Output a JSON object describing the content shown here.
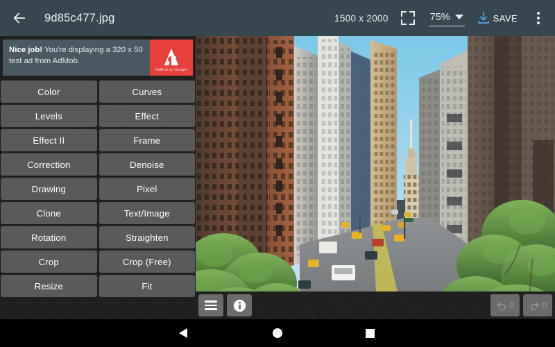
{
  "topbar": {
    "back_icon": "back-arrow-icon",
    "title": "9d85c477.jpg",
    "dimensions": "1500 x 2000",
    "fullscreen_icon": "fullscreen-icon",
    "zoom_value": "75%",
    "zoom_caret_icon": "chevron-down-icon",
    "save_icon": "download-icon",
    "save_label": "SAVE",
    "overflow_icon": "more-vertical-icon",
    "bg_color": "#36474f"
  },
  "ad": {
    "headline": "Nice job!",
    "body": " You're displaying a 320 x 50 test ad from AdMob.",
    "logo_caption": "AdMob by Google",
    "logo_color": "#e8403a",
    "banner_color": "#4b5a62"
  },
  "tools": {
    "buttons": [
      {
        "label": "Color"
      },
      {
        "label": "Curves"
      },
      {
        "label": "Levels"
      },
      {
        "label": "Effect"
      },
      {
        "label": "Effect II"
      },
      {
        "label": "Frame"
      },
      {
        "label": "Correction"
      },
      {
        "label": "Denoise"
      },
      {
        "label": "Drawing"
      },
      {
        "label": "Pixel"
      },
      {
        "label": "Clone"
      },
      {
        "label": "Text/Image"
      },
      {
        "label": "Rotation"
      },
      {
        "label": "Straighten"
      },
      {
        "label": "Crop"
      },
      {
        "label": "Crop (Free)"
      },
      {
        "label": "Resize"
      },
      {
        "label": "Fit"
      }
    ],
    "button_color": "#5a5a5a"
  },
  "image_toolbar": {
    "menu_icon": "hamburger-menu-icon",
    "info_icon": "info-icon",
    "undo_icon": "undo-icon",
    "undo_count": "0",
    "redo_icon": "redo-icon",
    "redo_count": "0"
  },
  "photo": {
    "description": "city-street-canyon-photo",
    "sky_color": "#8fd2ec"
  },
  "navbar": {
    "back_icon": "nav-back-triangle-icon",
    "home_icon": "nav-home-circle-icon",
    "recents_icon": "nav-recents-square-icon"
  }
}
